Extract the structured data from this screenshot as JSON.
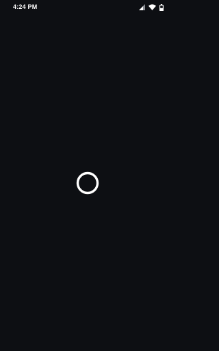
{
  "status_bar": {
    "time": "4:24 PM",
    "icons": [
      "signal-icon",
      "wifi-icon",
      "battery-icon"
    ]
  },
  "main": {
    "indicator": "loading-spinner-icon"
  },
  "colors": {
    "background": "#0d0f13",
    "foreground": "#ffffff"
  }
}
